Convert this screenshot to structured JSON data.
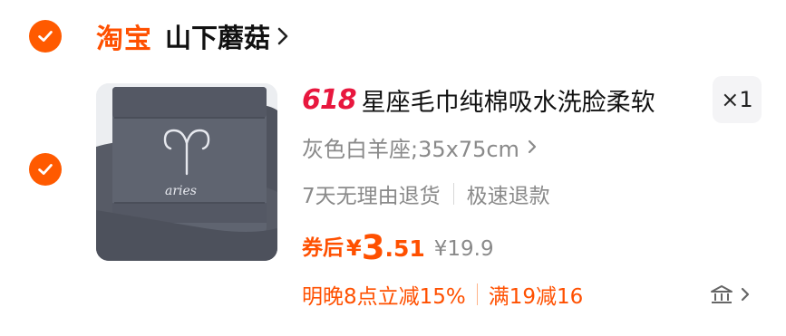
{
  "shop": {
    "logo_text": "淘宝",
    "name": "山下蘑菇"
  },
  "item": {
    "promo_tag": "618",
    "title": "星座毛巾纯棉吸水洗脸柔软",
    "quantity": "×1",
    "variant": "灰色白羊座;35x75cm",
    "services": [
      "7天无理由退货",
      "极速退款"
    ],
    "price": {
      "label": "券后",
      "currency": "¥",
      "integer": "3",
      "decimal": ".51",
      "original": "¥19.9"
    },
    "coupons": [
      "明晚8点立减15%",
      "满19减16"
    ],
    "image_text": "aries",
    "image_colors": {
      "towel": "#5e636f",
      "towel_dark": "#4f535e",
      "background": "#eceef1"
    }
  },
  "colors": {
    "accent": "#ff5000",
    "check": "#ff5a00",
    "promo": "#e8173e",
    "muted": "#8a8a8a"
  },
  "icons": [
    "check-icon",
    "chevron-right-icon",
    "coupon-detail-icon"
  ]
}
